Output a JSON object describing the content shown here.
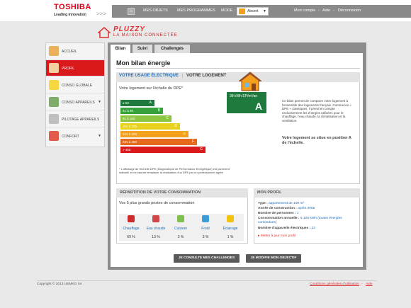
{
  "brand": {
    "logo": "TOSHIBA",
    "tagline_a": "Leading Innovation",
    "tagline_b": ">>>"
  },
  "nav": {
    "items": [
      "MES OBJETS",
      "MES PROGRAMMES"
    ],
    "mode_label": "MODE :",
    "mode_value": "Absent",
    "account": "Mon compte",
    "help": "Aide",
    "logout": "Déconnexion",
    "sep": "-"
  },
  "app": {
    "name": "PLUZZY",
    "subtitle": "LA MAISON CONNECTÉE"
  },
  "sidebar": {
    "items": [
      {
        "label": "ACCUEIL"
      },
      {
        "label": "PROFIL"
      },
      {
        "label": "CONSO GLOBALE"
      },
      {
        "label": "CONSO APPAREILS"
      },
      {
        "label": "PILOTAGE APPAREILS"
      },
      {
        "label": "CONFORT"
      }
    ]
  },
  "tabs": [
    "Bilan",
    "Suivi",
    "Challenges"
  ],
  "page": {
    "title": "Mon bilan énergie"
  },
  "usage": {
    "tab_active": "VOTRE USAGE ÉLECTRIQUE",
    "sep": "|",
    "tab_other": "VOTRE LOGEMENT",
    "dpe_title": "Votre logement sur l'échelle du DPE*",
    "bars": [
      {
        "range": "≤ 50",
        "letter": "A",
        "color": "#1f7a3d"
      },
      {
        "range": "51 à 90",
        "letter": "B",
        "color": "#35a23c"
      },
      {
        "range": "91 à 150",
        "letter": "C",
        "color": "#8cc63f"
      },
      {
        "range": "151 à 230",
        "letter": "D",
        "color": "#e8d21d"
      },
      {
        "range": "231 à 330",
        "letter": "E",
        "color": "#f3a01d"
      },
      {
        "range": "331 à 450",
        "letter": "F",
        "color": "#e66a1e"
      },
      {
        "range": "> 450",
        "letter": "G",
        "color": "#d9191c"
      }
    ],
    "current_value": "38 kWh EP/m²/an",
    "current_letter": "A",
    "footnote": "* L'affichage de l'échelle DPE (Diagnostique de Performance Energétique) est purement indicatif, et ne saurait remplacer la réalisation d'un DPE par un professionnel agréé",
    "description": "Ce bilan permet de comparer votre logement à l'ensemble des logements français. Comme les « DPE » classiques, il prend en compte exclusivement les énergies utilisées pour le chauffage, l'eau chaude, la climatisation et la ventilation.",
    "result": "Votre logement se situe en position A de l'échelle."
  },
  "conso": {
    "title": "RÉPARTITION DE VOTRE CONSOMMATION",
    "subtitle": "Vos 5 plus grands postes de consommation",
    "items": [
      {
        "label": "Chauffage",
        "pct": "69 %",
        "icon": "radiator-icon",
        "color": "#cc2b2b"
      },
      {
        "label": "Eau chaude",
        "pct": "13 %",
        "icon": "water-heater-icon",
        "color": "#d04545"
      },
      {
        "label": "Cuisson",
        "pct": "3 %",
        "icon": "cooking-icon",
        "color": "#7fbf4d"
      },
      {
        "label": "Froid",
        "pct": "3 %",
        "icon": "snowflake-icon",
        "color": "#3c9cd8"
      },
      {
        "label": "Éclairage",
        "pct": "1 %",
        "icon": "bulb-icon",
        "color": "#f1c40f"
      }
    ]
  },
  "profil": {
    "title": "MON PROFIL",
    "type_label": "Type :",
    "type_value": "appartement de 100 m²",
    "year_label": "Année de construction :",
    "year_value": "après 2005",
    "persons_label": "Nombre de personnes :",
    "persons_value": "1",
    "conso_label": "Consommation annuelle :",
    "conso_value": "6 100 kWh (toutes énergies confondues)",
    "devices_label": "Nombre d'appareils électriques :",
    "devices_value": "23",
    "link": "▸ Mettre à jour mon profil"
  },
  "buttons": {
    "challenges": "JE CONSULTE MES CHALLENGES",
    "objective": "JE MODIFIE MON OBJECTIF"
  },
  "footer": {
    "copyright": "Copyright © 2013 UEMKO SA",
    "terms": "Conditions générales d'utilisation",
    "sep": "-",
    "help": "Aide"
  }
}
